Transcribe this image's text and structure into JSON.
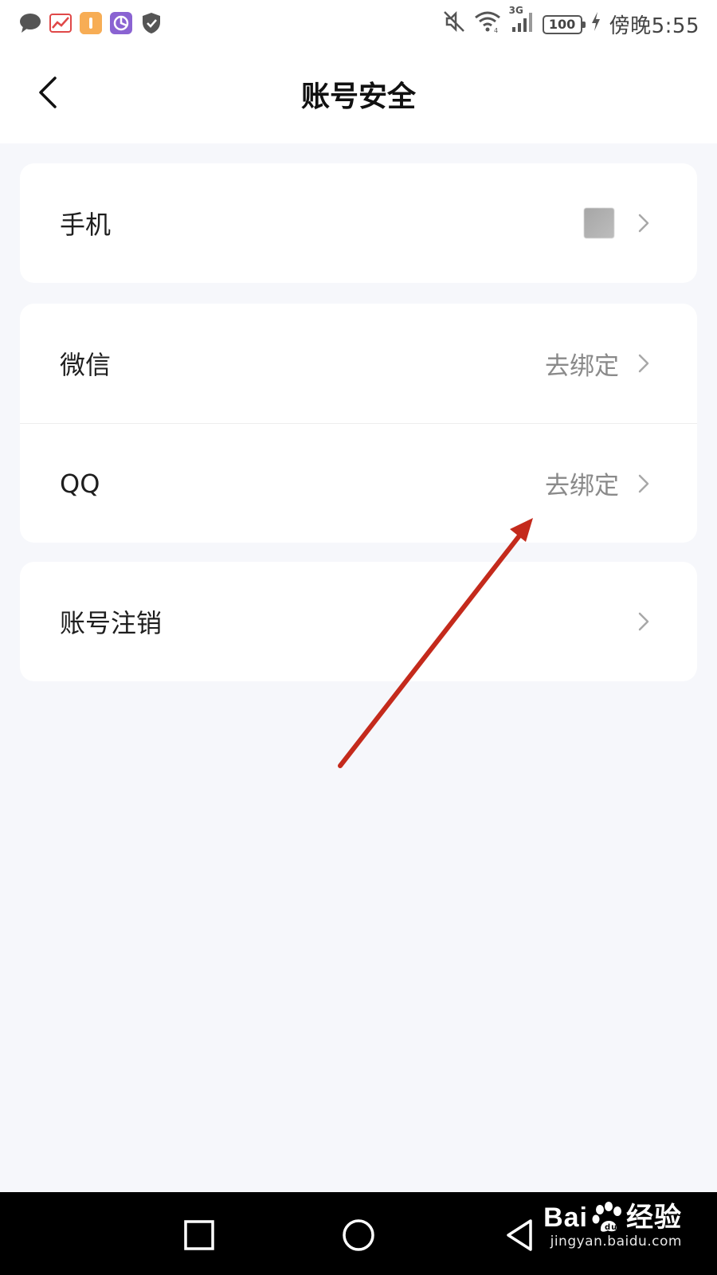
{
  "status_bar": {
    "time": "傍晚5:55",
    "battery": "100",
    "network": "3G",
    "icons": [
      "message-icon",
      "stock-app-icon",
      "orange-app-icon",
      "purple-app-icon",
      "shield-icon",
      "mute-icon",
      "wifi-icon",
      "signal-icon",
      "battery-icon",
      "charging-icon"
    ]
  },
  "header": {
    "title": "账号安全",
    "back_icon": "chevron-left-icon"
  },
  "settings": {
    "phone": {
      "label": "手机"
    },
    "wechat": {
      "label": "微信",
      "value": "去绑定"
    },
    "qq": {
      "label": "QQ",
      "value": "去绑定"
    },
    "deactivate": {
      "label": "账号注销"
    }
  },
  "colors": {
    "background": "#f6f7fb",
    "card": "#ffffff",
    "secondary_text": "#8a8a8a",
    "annotation_arrow": "#c42a1c",
    "nav_bar": "#000000"
  },
  "watermark": {
    "brand_prefix": "Bai",
    "brand_suffix": "经验",
    "url": "jingyan.baidu.com"
  }
}
